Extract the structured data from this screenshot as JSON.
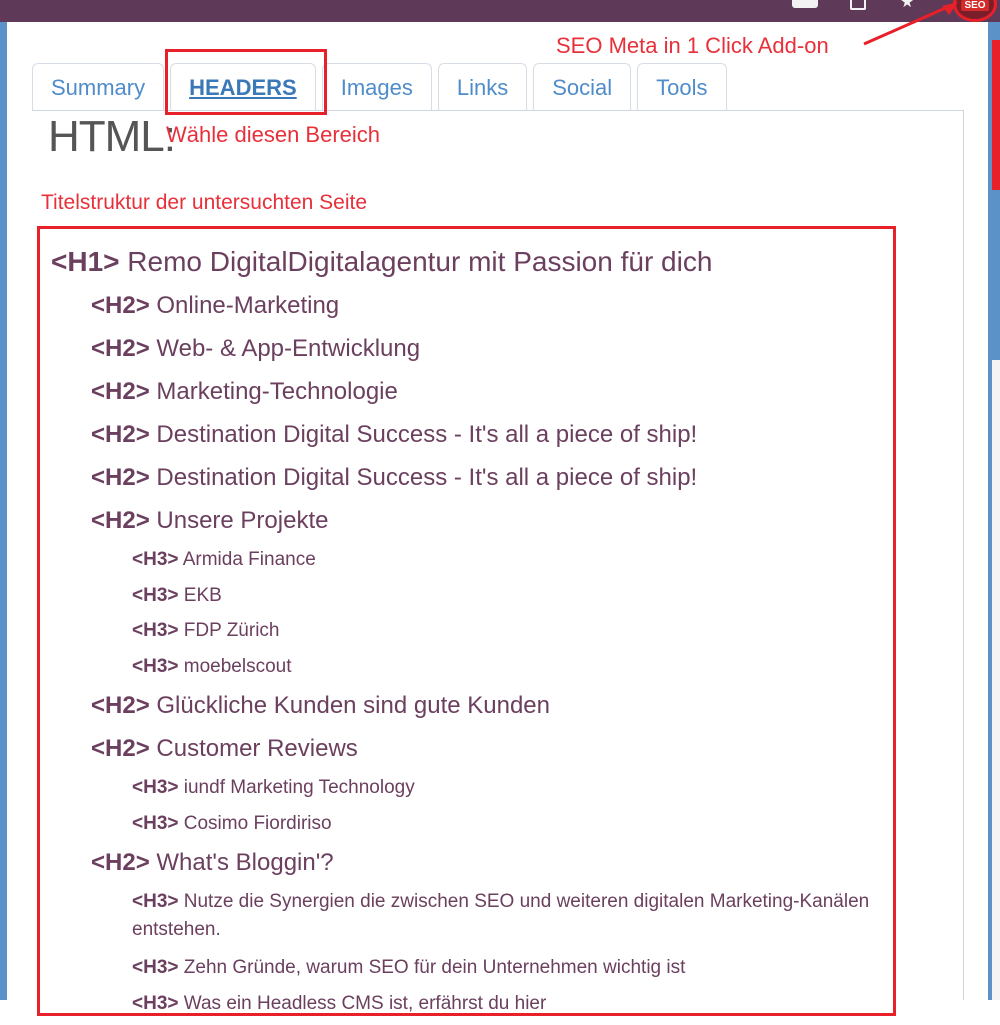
{
  "browser": {
    "extension_badge": "SEO",
    "colors": {
      "topbar": "#5e3a58",
      "frame": "#5b93c9",
      "annotation": "#e8202a"
    }
  },
  "annotations": {
    "addon": "SEO Meta in 1 Click Add-on",
    "select_area": "Wähle diesen Bereich",
    "structure": "Titelstruktur der untersuchten Seite"
  },
  "tabs": [
    {
      "label": "Summary",
      "active": false
    },
    {
      "label": "HEADERS",
      "active": true
    },
    {
      "label": "Images",
      "active": false
    },
    {
      "label": "Links",
      "active": false
    },
    {
      "label": "Social",
      "active": false
    },
    {
      "label": "Tools",
      "active": false
    }
  ],
  "section_heading": "HTML:",
  "headers": [
    {
      "tag": "<H1>",
      "text": "Remo DigitalDigitalagentur mit Passion für dich"
    },
    {
      "tag": "<H2>",
      "text": "Online-Marketing"
    },
    {
      "tag": "<H2>",
      "text": "Web- & App-Entwicklung"
    },
    {
      "tag": "<H2>",
      "text": "Marketing-Technologie"
    },
    {
      "tag": "<H2>",
      "text": "Destination Digital Success - It's all a piece of ship!"
    },
    {
      "tag": "<H2>",
      "text": "Destination Digital Success - It's all a piece of ship!"
    },
    {
      "tag": "<H2>",
      "text": "Unsere Projekte"
    },
    {
      "tag": "<H3>",
      "text": "Armida Finance"
    },
    {
      "tag": "<H3>",
      "text": "EKB"
    },
    {
      "tag": "<H3>",
      "text": "FDP Zürich"
    },
    {
      "tag": "<H3>",
      "text": "moebelscout"
    },
    {
      "tag": "<H2>",
      "text": "Glückliche Kunden sind gute Kunden"
    },
    {
      "tag": "<H2>",
      "text": "Customer Reviews"
    },
    {
      "tag": "<H3>",
      "text": "iundf Marketing Technology"
    },
    {
      "tag": "<H3>",
      "text": "Cosimo Fiordiriso"
    },
    {
      "tag": "<H2>",
      "text": "What's Bloggin'?"
    },
    {
      "tag": "<H3>",
      "text": "Nutze die Synergien die zwischen SEO und weiteren digitalen Marketing-Kanälen entstehen."
    },
    {
      "tag": "<H3>",
      "text": "Zehn Gründe, warum SEO für dein Unternehmen wichtig ist"
    },
    {
      "tag": "<H3>",
      "text": "Was ein Headless CMS ist, erfährst du hier"
    }
  ]
}
